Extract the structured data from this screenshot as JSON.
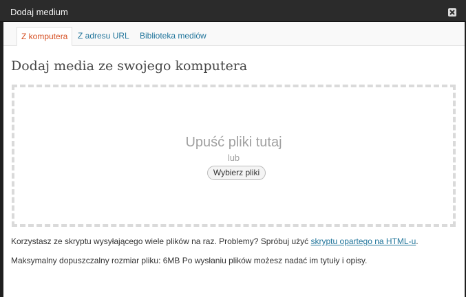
{
  "window": {
    "title": "Dodaj medium"
  },
  "tabs": [
    {
      "label": "Z komputera",
      "active": true
    },
    {
      "label": "Z adresu URL",
      "active": false
    },
    {
      "label": "Biblioteka mediów",
      "active": false
    }
  ],
  "main": {
    "heading": "Dodaj media ze swojego komputera",
    "dropzone": {
      "title": "Upuść pliki tutaj",
      "or": "lub",
      "browse_label": "Wybierz pliki"
    },
    "info1": {
      "text": "Korzystasz ze skryptu wysyłającego wiele plików na raz. Problemy? Spróbuj użyć ",
      "link": "skryptu opartego na HTML-u",
      "suffix": "."
    },
    "info2": "Maksymalny dopuszczalny rozmiar pliku: 6MB Po wysłaniu plików możesz nadać im tytuły i opisy."
  },
  "colors": {
    "link": "#21759b",
    "active_tab": "#d54e21",
    "titlebar": "#2b2b2b"
  },
  "icons": [
    "close-icon"
  ]
}
